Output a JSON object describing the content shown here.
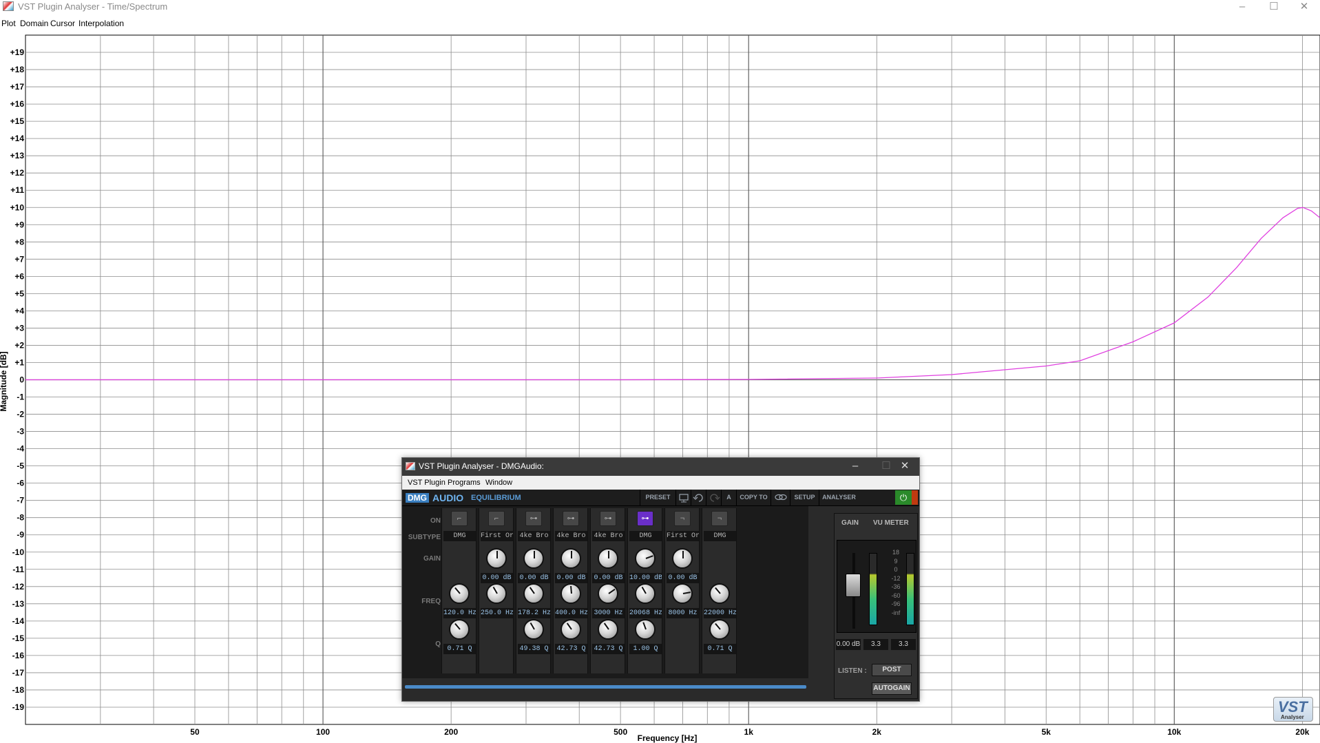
{
  "window": {
    "title": "VST Plugin Analyser - Time/Spectrum",
    "minimize_glyph": "–",
    "maximize_glyph": "☐",
    "close_glyph": "✕"
  },
  "menu": [
    "Plot",
    "Domain",
    "Cursor",
    "Interpolation"
  ],
  "chart_data": {
    "type": "line",
    "xlabel": "Frequency [Hz]",
    "ylabel": "Magnitude [dB]",
    "xscale": "log",
    "xlim": [
      20,
      22000
    ],
    "ylim": [
      -20,
      20
    ],
    "grid": true,
    "x_tick_labels": [
      "50",
      "100",
      "200",
      "500",
      "1k",
      "2k",
      "5k",
      "10k",
      "20k"
    ],
    "x_tick_values": [
      50,
      100,
      200,
      500,
      1000,
      2000,
      5000,
      10000,
      20000
    ],
    "y_tick_labels": [
      "+19",
      "+18",
      "+17",
      "+16",
      "+15",
      "+14",
      "+13",
      "+12",
      "+11",
      "+10",
      "+9",
      "+8",
      "+7",
      "+6",
      "+5",
      "+4",
      "+3",
      "+2",
      "+1",
      "0",
      "-1",
      "-2",
      "-3",
      "-4",
      "-5",
      "-6",
      "-7",
      "-8",
      "-9",
      "-10",
      "-11",
      "-12",
      "-13",
      "-14",
      "-15",
      "-16",
      "-17",
      "-18",
      "-19"
    ],
    "series": [
      {
        "color": "#e040e0",
        "x": [
          20,
          100,
          500,
          1000,
          2000,
          3000,
          5000,
          6000,
          8000,
          10000,
          12000,
          14000,
          16000,
          18000,
          19500,
          20068,
          21000,
          22000
        ],
        "y": [
          0,
          0,
          0,
          0.02,
          0.1,
          0.3,
          0.8,
          1.1,
          2.2,
          3.3,
          4.8,
          6.5,
          8.2,
          9.4,
          9.95,
          10.0,
          9.8,
          9.4
        ]
      }
    ]
  },
  "plugin": {
    "title": "VST Plugin Analyser - DMGAudio:",
    "menu": [
      "VST Plugin",
      "Programs",
      "Window"
    ],
    "brand": {
      "dmg": "DMG",
      "audio": "AUDIO",
      "product": "EQUILIBRIUM"
    },
    "toolbar": [
      "PRESET",
      "A",
      "COPY TO",
      "SETUP",
      "ANALYSER"
    ],
    "row_labels": {
      "on": "ON",
      "subtype": "SUBTYPE",
      "gain": "GAIN",
      "freq": "FREQ",
      "q": "Q"
    },
    "bands": [
      {
        "on_icon": "low-shelf-icon",
        "subtype": "DMG",
        "gain": "",
        "freq": "120.0 Hz",
        "q": "0.71 Q",
        "active": false,
        "gain_rot": 0,
        "freq_rot": -40,
        "q_rot": -40,
        "show_gain": false,
        "show_q": true
      },
      {
        "on_icon": "low-shelf-icon",
        "subtype": "First Or",
        "gain": "0.00 dB",
        "freq": "250.0 Hz",
        "q": "",
        "active": false,
        "gain_rot": 0,
        "freq_rot": -30,
        "q_rot": 0,
        "show_gain": true,
        "show_q": false
      },
      {
        "on_icon": "bell-icon",
        "subtype": "4ke Bro",
        "gain": "0.00 dB",
        "freq": "178.2 Hz",
        "q": "49.38 Q",
        "active": false,
        "gain_rot": 0,
        "freq_rot": -35,
        "q_rot": -30,
        "show_gain": true,
        "show_q": true
      },
      {
        "on_icon": "bell-icon",
        "subtype": "4ke Bro",
        "gain": "0.00 dB",
        "freq": "400.0 Hz",
        "q": "42.73 Q",
        "active": false,
        "gain_rot": 0,
        "freq_rot": -5,
        "q_rot": -35,
        "show_gain": true,
        "show_q": true
      },
      {
        "on_icon": "bell-icon",
        "subtype": "4ke Bro",
        "gain": "0.00 dB",
        "freq": "3000 Hz",
        "q": "42.73 Q",
        "active": false,
        "gain_rot": 0,
        "freq_rot": 55,
        "q_rot": -35,
        "show_gain": true,
        "show_q": true
      },
      {
        "on_icon": "bell-icon",
        "subtype": "DMG",
        "gain": "10.00 dB",
        "freq": "20068 Hz",
        "q": "1.00 Q",
        "active": true,
        "gain_rot": 70,
        "freq_rot": -30,
        "q_rot": -20,
        "show_gain": true,
        "show_q": true
      },
      {
        "on_icon": "high-shelf-icon",
        "subtype": "First Or",
        "gain": "0.00 dB",
        "freq": "8000 Hz",
        "q": "",
        "active": false,
        "gain_rot": 0,
        "freq_rot": 80,
        "q_rot": 0,
        "show_gain": true,
        "show_q": false
      },
      {
        "on_icon": "high-shelf-icon",
        "subtype": "DMG",
        "gain": "",
        "freq": "22000 Hz",
        "q": "0.71 Q",
        "active": false,
        "gain_rot": 0,
        "freq_rot": -40,
        "q_rot": -40,
        "show_gain": false,
        "show_q": true
      }
    ],
    "right_panel": {
      "gain_header": "GAIN",
      "vu_header": "VU METER",
      "scale": [
        "18",
        "9",
        "0",
        "-12",
        "-36",
        "-60",
        "-96",
        "-inf"
      ],
      "gain_value": "0.00 dB",
      "vu_left": "3.3",
      "vu_right": "3.3",
      "listen_label": "LISTEN :",
      "post_label": "POST",
      "autogain_label": "AUTOGAIN"
    }
  },
  "logo": {
    "text": "VST",
    "sub": "Analyser"
  }
}
